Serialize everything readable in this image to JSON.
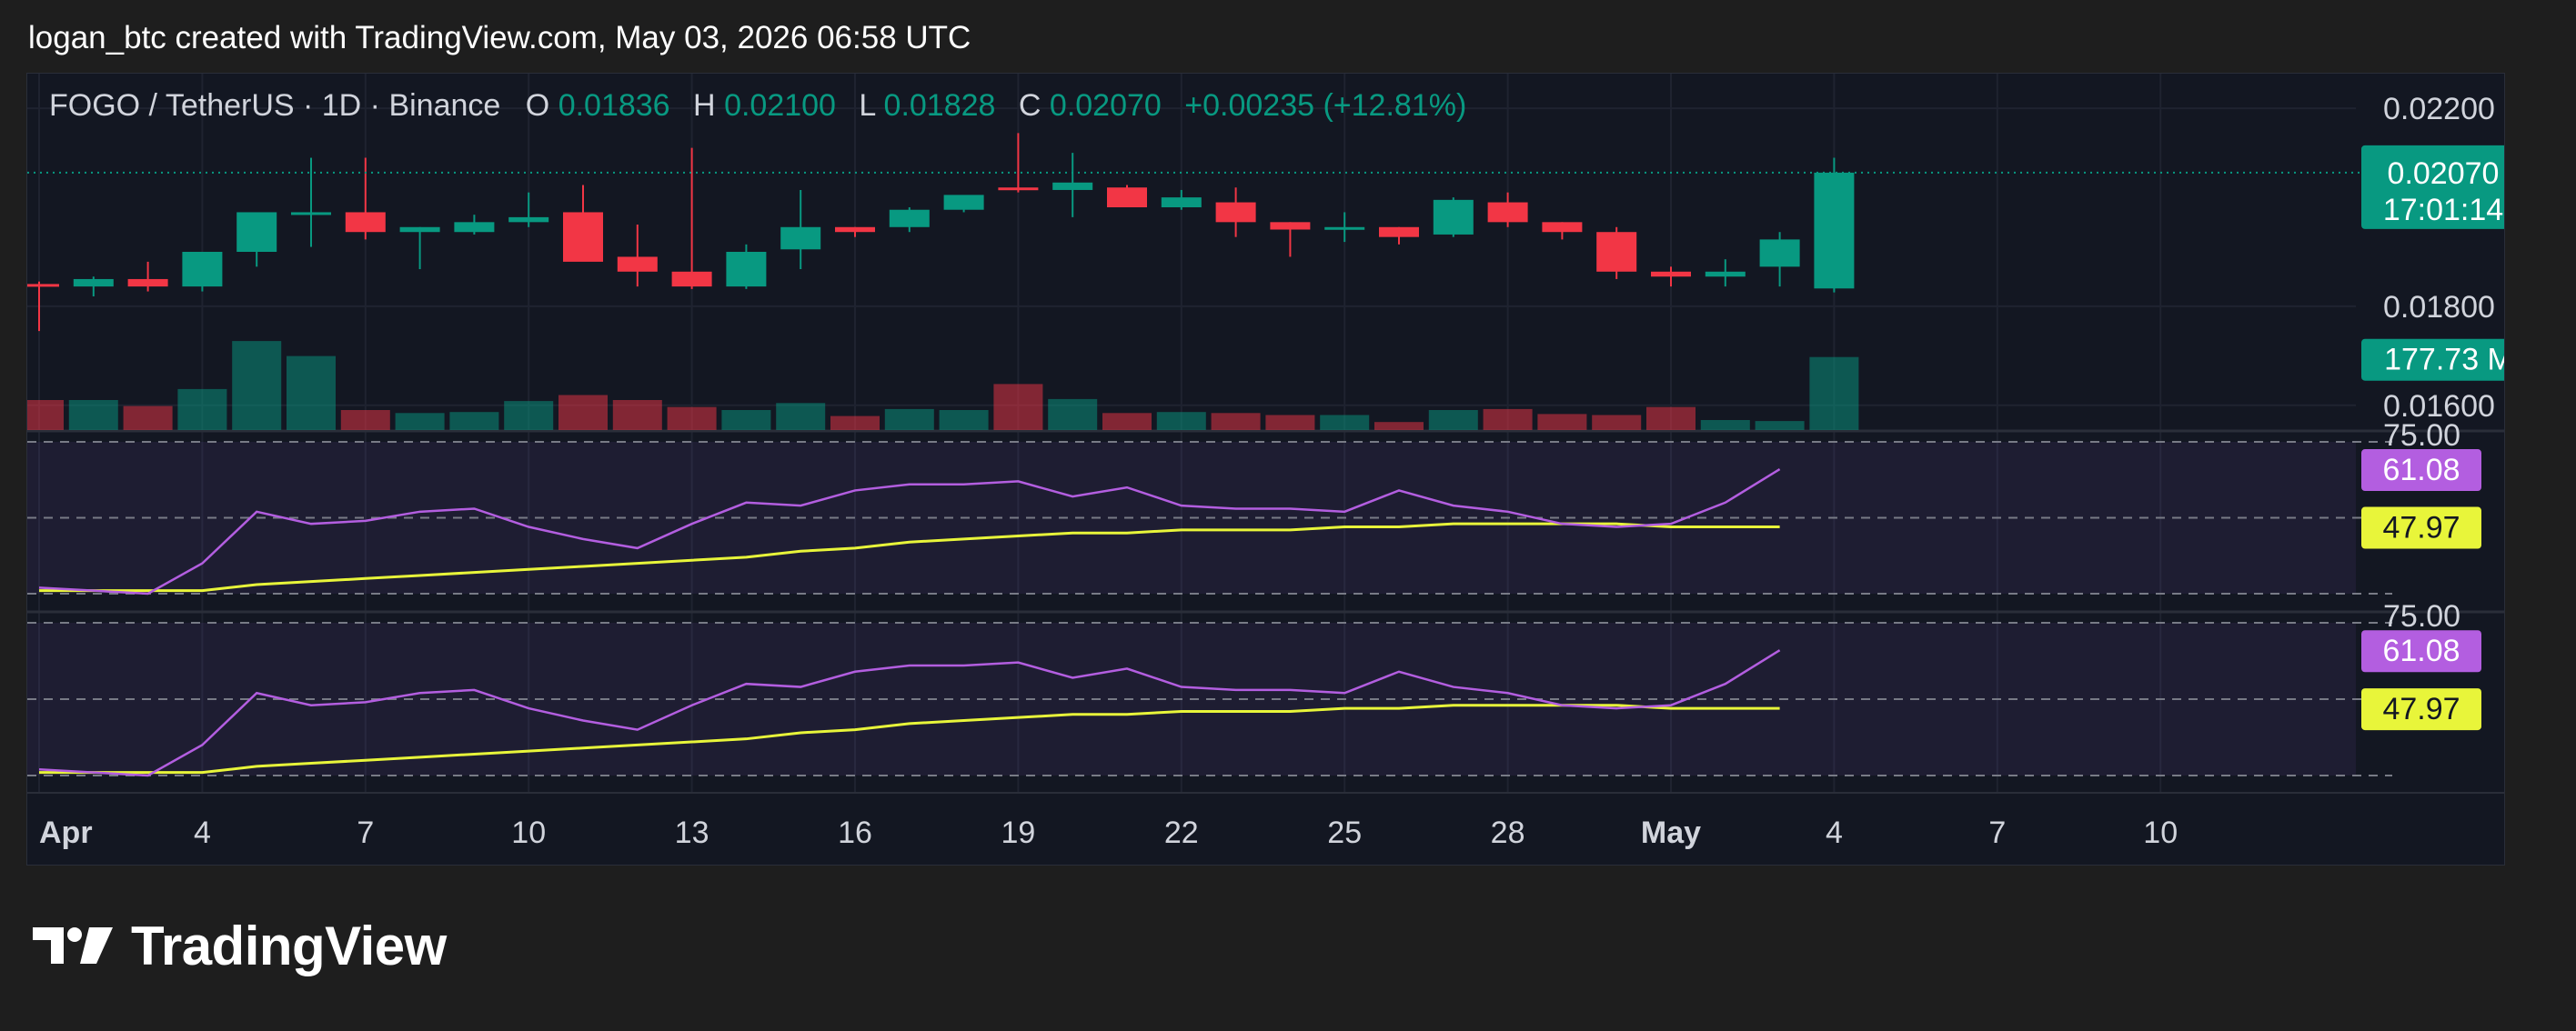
{
  "header_text": "logan_btc created with TradingView.com, May 03, 2026 06:58 UTC",
  "legend": {
    "symbol": "FOGO / TetherUS · 1D · Binance",
    "o_label": "O",
    "o_value": "0.01836",
    "h_label": "H",
    "h_value": "0.02100",
    "l_label": "L",
    "l_value": "0.01828",
    "c_label": "C",
    "c_value": "0.02070",
    "change": "+0.00235 (+12.81%)"
  },
  "price_badges": {
    "last_price": "0.02070",
    "countdown": "17:01:14",
    "volume": "177.73 M"
  },
  "rsi_badges": {
    "rsi": "61.08",
    "ma": "47.97"
  },
  "logo_text": "TradingView",
  "colors": {
    "up": "#089981",
    "down": "#f23645",
    "rsi": "#b35ee0",
    "rsi_ma": "#e8f53a",
    "background": "#131722",
    "page": "#1e1e1e"
  },
  "chart_data": {
    "type": "candlestick",
    "price_axis": {
      "ylim": [
        0.0155,
        0.0227
      ],
      "ticks": [
        "0.02200",
        "0.01800",
        "0.01600"
      ]
    },
    "x_axis": {
      "ticks": [
        {
          "label": "Apr",
          "index": 0,
          "bold": true
        },
        {
          "label": "4",
          "index": 3
        },
        {
          "label": "7",
          "index": 6
        },
        {
          "label": "10",
          "index": 9
        },
        {
          "label": "13",
          "index": 12
        },
        {
          "label": "16",
          "index": 15
        },
        {
          "label": "19",
          "index": 18
        },
        {
          "label": "22",
          "index": 21
        },
        {
          "label": "25",
          "index": 24
        },
        {
          "label": "28",
          "index": 27
        },
        {
          "label": "May",
          "index": 30,
          "bold": true
        },
        {
          "label": "4",
          "index": 33
        },
        {
          "label": "7",
          "index": 36
        },
        {
          "label": "10",
          "index": 39
        }
      ]
    },
    "candles": [
      {
        "o": 0.01845,
        "h": 0.0185,
        "l": 0.0175,
        "c": 0.0184
      },
      {
        "o": 0.0184,
        "h": 0.0186,
        "l": 0.0182,
        "c": 0.01855
      },
      {
        "o": 0.01855,
        "h": 0.0189,
        "l": 0.0183,
        "c": 0.0184
      },
      {
        "o": 0.0184,
        "h": 0.0191,
        "l": 0.0183,
        "c": 0.0191
      },
      {
        "o": 0.0191,
        "h": 0.0193,
        "l": 0.0188,
        "c": 0.0199
      },
      {
        "o": 0.0199,
        "h": 0.021,
        "l": 0.0192,
        "c": 0.0199
      },
      {
        "o": 0.0199,
        "h": 0.021,
        "l": 0.01935,
        "c": 0.0195
      },
      {
        "o": 0.0195,
        "h": 0.0196,
        "l": 0.01875,
        "c": 0.0196
      },
      {
        "o": 0.0195,
        "h": 0.01985,
        "l": 0.01945,
        "c": 0.0197
      },
      {
        "o": 0.0197,
        "h": 0.0203,
        "l": 0.0196,
        "c": 0.0198
      },
      {
        "o": 0.0199,
        "h": 0.02045,
        "l": 0.019,
        "c": 0.0189
      },
      {
        "o": 0.019,
        "h": 0.01965,
        "l": 0.0184,
        "c": 0.0187
      },
      {
        "o": 0.0187,
        "h": 0.0212,
        "l": 0.01835,
        "c": 0.0184
      },
      {
        "o": 0.0184,
        "h": 0.01925,
        "l": 0.01835,
        "c": 0.0191
      },
      {
        "o": 0.01915,
        "h": 0.02035,
        "l": 0.01875,
        "c": 0.0196
      },
      {
        "o": 0.0196,
        "h": 0.0196,
        "l": 0.0194,
        "c": 0.0195
      },
      {
        "o": 0.0196,
        "h": 0.02,
        "l": 0.0195,
        "c": 0.01995
      },
      {
        "o": 0.01995,
        "h": 0.0201,
        "l": 0.0199,
        "c": 0.02025
      },
      {
        "o": 0.0204,
        "h": 0.0215,
        "l": 0.0203,
        "c": 0.02035
      },
      {
        "o": 0.02035,
        "h": 0.0211,
        "l": 0.0198,
        "c": 0.0205
      },
      {
        "o": 0.0204,
        "h": 0.02045,
        "l": 0.02,
        "c": 0.02
      },
      {
        "o": 0.02,
        "h": 0.02035,
        "l": 0.01995,
        "c": 0.0202
      },
      {
        "o": 0.0201,
        "h": 0.0204,
        "l": 0.0194,
        "c": 0.0197
      },
      {
        "o": 0.0197,
        "h": 0.0197,
        "l": 0.019,
        "c": 0.01955
      },
      {
        "o": 0.0196,
        "h": 0.0199,
        "l": 0.0193,
        "c": 0.0196
      },
      {
        "o": 0.0196,
        "h": 0.0196,
        "l": 0.01925,
        "c": 0.0194
      },
      {
        "o": 0.01945,
        "h": 0.0202,
        "l": 0.0194,
        "c": 0.02015
      },
      {
        "o": 0.0201,
        "h": 0.0203,
        "l": 0.0196,
        "c": 0.0197
      },
      {
        "o": 0.0197,
        "h": 0.0197,
        "l": 0.01935,
        "c": 0.0195
      },
      {
        "o": 0.0195,
        "h": 0.0196,
        "l": 0.01855,
        "c": 0.0187
      },
      {
        "o": 0.0187,
        "h": 0.0188,
        "l": 0.0184,
        "c": 0.0186
      },
      {
        "o": 0.0186,
        "h": 0.01895,
        "l": 0.0184,
        "c": 0.0187
      },
      {
        "o": 0.0188,
        "h": 0.0195,
        "l": 0.0184,
        "c": 0.01935
      },
      {
        "o": 0.01836,
        "h": 0.021,
        "l": 0.01828,
        "c": 0.0207
      }
    ],
    "volume": [
      0.3,
      0.3,
      0.24,
      0.41,
      0.89,
      0.74,
      0.2,
      0.17,
      0.18,
      0.29,
      0.35,
      0.3,
      0.23,
      0.2,
      0.27,
      0.14,
      0.21,
      0.2,
      0.46,
      0.31,
      0.17,
      0.18,
      0.17,
      0.15,
      0.15,
      0.08,
      0.2,
      0.21,
      0.16,
      0.15,
      0.23,
      0.1,
      0.09,
      0.73
    ],
    "volume_last_label": "177.73 M",
    "rsi": {
      "levels": [
        75.0,
        50.0,
        25.0
      ],
      "level_top_label": "75.00",
      "rsi_values": [
        27,
        26,
        25,
        35,
        52,
        48,
        49,
        52,
        53,
        47,
        43,
        40,
        48,
        55,
        54,
        59,
        61,
        61,
        62,
        57,
        60,
        54,
        53,
        53,
        52,
        59,
        54,
        52,
        48,
        47,
        48,
        55,
        66
      ],
      "ma_values": [
        26,
        26,
        26,
        26,
        28,
        29,
        30,
        31,
        32,
        33,
        34,
        35,
        36,
        37,
        39,
        40,
        42,
        43,
        44,
        45,
        45,
        46,
        46,
        46,
        47,
        47,
        48,
        48,
        48,
        48,
        47,
        47,
        47
      ],
      "rsi_last": 61.08,
      "ma_last": 47.97
    }
  }
}
